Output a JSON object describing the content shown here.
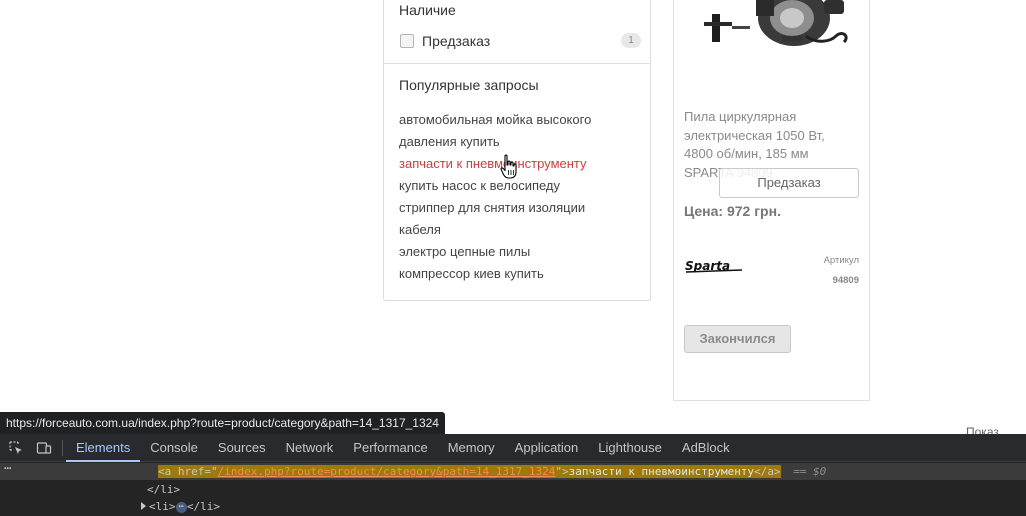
{
  "filter": {
    "availability_title": "Наличие",
    "preorder_label": "Предзаказ",
    "preorder_count": "1",
    "popular_title": "Популярные запросы",
    "popular_queries": [
      "автомобильная мойка высокого",
      "давления купить",
      "запчасти к пневмоинструменту",
      "купить насос к велосипеду",
      "стриппер для снятия изоляции",
      "кабеля",
      "электро цепные пилы",
      "компрессор киев купить"
    ]
  },
  "product": {
    "name": "Пила циркулярная электрическая 1050 Вт, 4800 об/мин, 185 мм SPARTA 94809",
    "preorder_button": "Предзаказ",
    "price": "Цена: 972 грн.",
    "brand": "Sparta",
    "sku_label": "Артикул",
    "sku_value": "94809",
    "soldout_button": "Закончился"
  },
  "page": {
    "right_cut_text": "Показ"
  },
  "status_bar": {
    "url": "https://forceauto.com.ua/index.php?route=product/category&path=14_1317_1324"
  },
  "devtools": {
    "tabs": [
      "Elements",
      "Console",
      "Sources",
      "Network",
      "Performance",
      "Memory",
      "Application",
      "Lighthouse",
      "AdBlock"
    ],
    "active_tab": "Elements",
    "selected_line": {
      "tag_open": "<a href=\"",
      "href": "/index.php?route=product/category&path=14_1317_1324",
      "tag_close_open": "\">",
      "text": "запчасти к пневмоинструменту",
      "tag_end": "</a>",
      "suffix": "== $0"
    },
    "line2": "</li>",
    "line3_open": "<li>",
    "line3_close": "</li>"
  },
  "colors": {
    "accent_link": "#c94040",
    "devtools_active": "#a8c7fa",
    "selection_highlight": "#9e7a0a"
  }
}
